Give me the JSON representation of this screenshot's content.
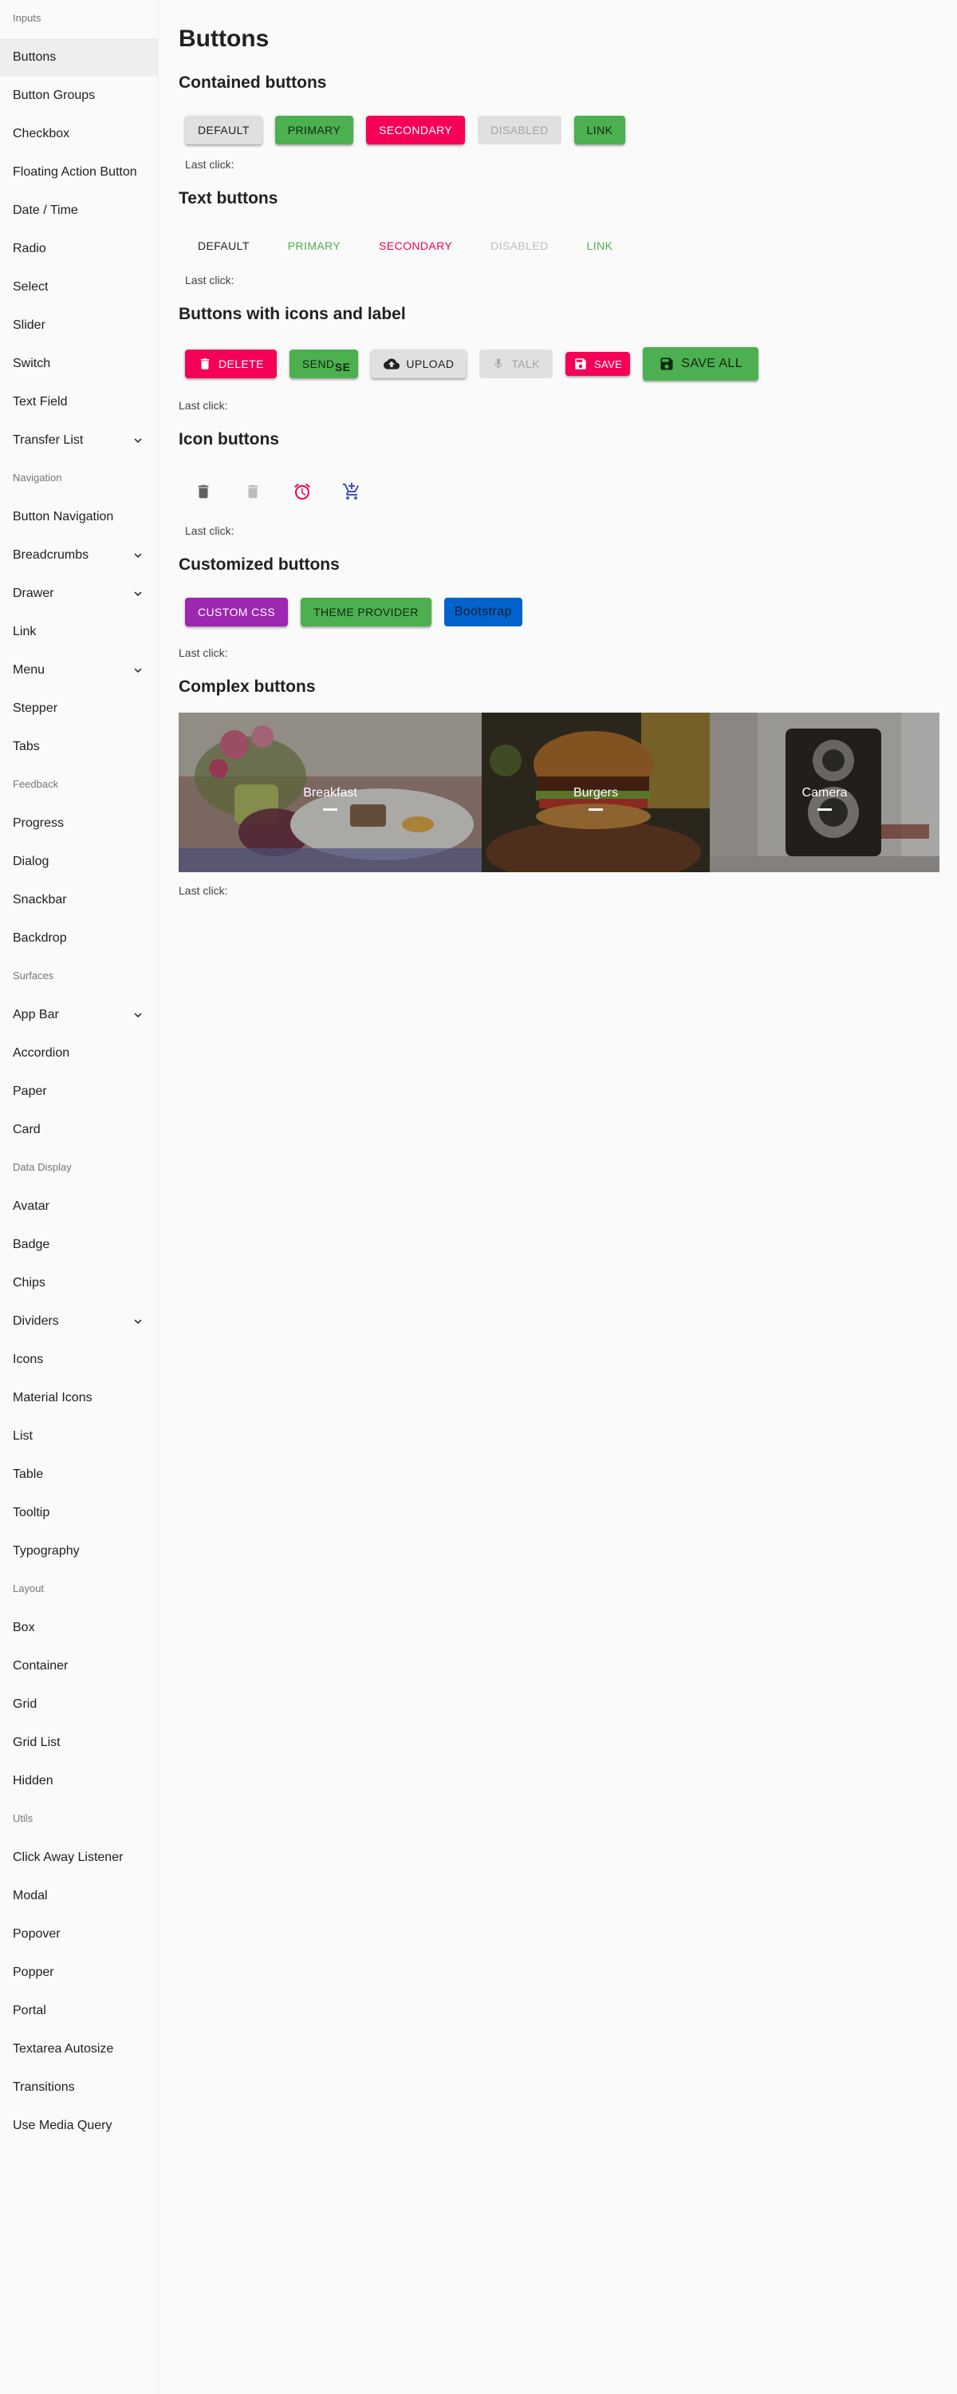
{
  "sidebar": {
    "groups": [
      {
        "header": "Inputs",
        "items": [
          {
            "label": "Buttons",
            "selected": true
          },
          {
            "label": "Button Groups"
          },
          {
            "label": "Checkbox"
          },
          {
            "label": "Floating Action Button"
          },
          {
            "label": "Date / Time"
          },
          {
            "label": "Radio"
          },
          {
            "label": "Select"
          },
          {
            "label": "Slider"
          },
          {
            "label": "Switch"
          },
          {
            "label": "Text Field"
          },
          {
            "label": "Transfer List",
            "expandable": true
          }
        ]
      },
      {
        "header": "Navigation",
        "items": [
          {
            "label": "Button Navigation"
          },
          {
            "label": "Breadcrumbs",
            "expandable": true
          },
          {
            "label": "Drawer",
            "expandable": true
          },
          {
            "label": "Link"
          },
          {
            "label": "Menu",
            "expandable": true
          },
          {
            "label": "Stepper"
          },
          {
            "label": "Tabs"
          }
        ]
      },
      {
        "header": "Feedback",
        "items": [
          {
            "label": "Progress"
          },
          {
            "label": "Dialog"
          },
          {
            "label": "Snackbar"
          },
          {
            "label": "Backdrop"
          }
        ]
      },
      {
        "header": "Surfaces",
        "items": [
          {
            "label": "App Bar",
            "expandable": true
          },
          {
            "label": "Accordion"
          },
          {
            "label": "Paper"
          },
          {
            "label": "Card"
          }
        ]
      },
      {
        "header": "Data Display",
        "items": [
          {
            "label": "Avatar"
          },
          {
            "label": "Badge"
          },
          {
            "label": "Chips"
          },
          {
            "label": "Dividers",
            "expandable": true
          },
          {
            "label": "Icons"
          },
          {
            "label": "Material Icons"
          },
          {
            "label": "List"
          },
          {
            "label": "Table"
          },
          {
            "label": "Tooltip"
          },
          {
            "label": "Typography"
          }
        ]
      },
      {
        "header": "Layout",
        "items": [
          {
            "label": "Box"
          },
          {
            "label": "Container"
          },
          {
            "label": "Grid"
          },
          {
            "label": "Grid List"
          },
          {
            "label": "Hidden"
          }
        ]
      },
      {
        "header": "Utils",
        "items": [
          {
            "label": "Click Away Listener"
          },
          {
            "label": "Modal"
          },
          {
            "label": "Popover"
          },
          {
            "label": "Popper"
          },
          {
            "label": "Portal"
          },
          {
            "label": "Textarea Autosize"
          },
          {
            "label": "Transitions"
          },
          {
            "label": "Use Media Query"
          }
        ]
      }
    ]
  },
  "main": {
    "title": "Buttons",
    "last_click_label": "Last click:",
    "contained": {
      "title": "Contained buttons",
      "default": "Default",
      "primary": "Primary",
      "secondary": "Secondary",
      "disabled": "Disabled",
      "link": "Link"
    },
    "text": {
      "title": "Text buttons",
      "default": "Default",
      "primary": "Primary",
      "secondary": "Secondary",
      "disabled": "Disabled",
      "link": "Link"
    },
    "icons_label": {
      "title": "Buttons with icons and label",
      "delete": "Delete",
      "send": "Send",
      "send_icon_text": "SE",
      "upload": "Upload",
      "talk": "Talk",
      "save": "Save",
      "save_all": "Save all"
    },
    "icon_buttons": {
      "title": "Icon buttons",
      "icons": [
        "delete-icon",
        "delete-icon-disabled",
        "alarm-icon",
        "add-shopping-cart-icon"
      ]
    },
    "customized": {
      "title": "Customized buttons",
      "custom_css": "Custom CSS",
      "theme_provider": "Theme Provider",
      "bootstrap": "Bootstrap"
    },
    "complex": {
      "title": "Complex buttons",
      "items": [
        {
          "label": "Breakfast"
        },
        {
          "label": "Burgers"
        },
        {
          "label": "Camera"
        }
      ]
    }
  },
  "colors": {
    "primary": "#4caf50",
    "secondary": "#f50057",
    "purple": "#9c27b0",
    "bootstrap": "#0063cc",
    "background": "#fafafa"
  }
}
